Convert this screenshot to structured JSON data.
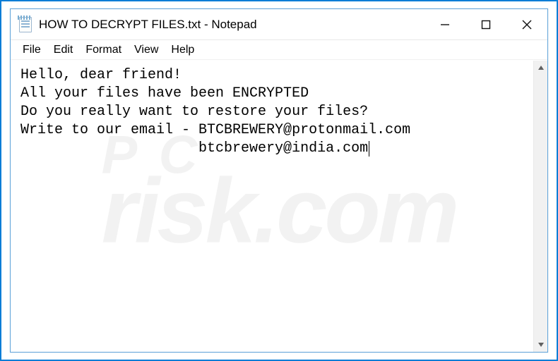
{
  "window": {
    "title": "HOW TO DECRYPT FILES.txt - Notepad"
  },
  "menu": {
    "file": "File",
    "edit": "Edit",
    "format": "Format",
    "view": "View",
    "help": "Help"
  },
  "content": {
    "line1": "Hello, dear friend!",
    "line2": "All your files have been ENCRYPTED",
    "line3": "Do you really want to restore your files?",
    "line4": "Write to our email - BTCBREWERY@protonmail.com",
    "line5": "                     btcbrewery@india.com"
  },
  "watermark": {
    "line1": "P C",
    "line2": "risk.com"
  }
}
